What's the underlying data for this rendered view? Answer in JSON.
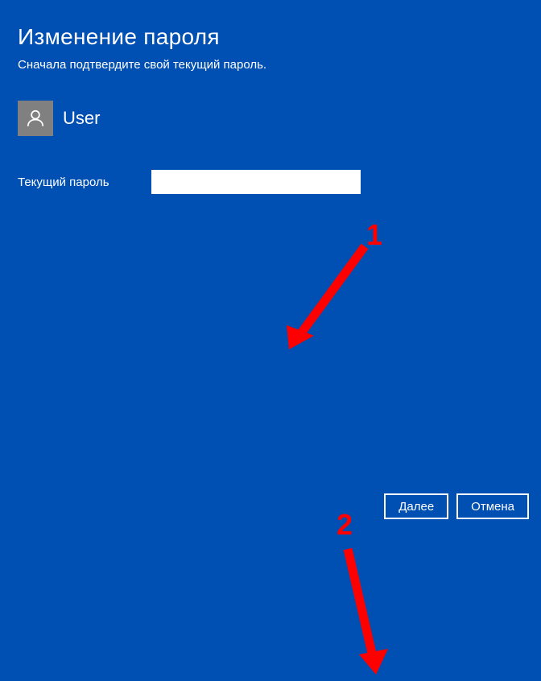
{
  "page": {
    "title": "Изменение пароля",
    "subtitle": "Сначала подтвердите свой текущий пароль."
  },
  "user": {
    "name": "User"
  },
  "fields": {
    "current_password": {
      "label": "Текущий пароль",
      "value": "",
      "placeholder": ""
    }
  },
  "buttons": {
    "next": "Далее",
    "cancel": "Отмена"
  },
  "annotations": {
    "one": "1",
    "two": "2"
  },
  "colors": {
    "background": "#004fb3",
    "annotation": "#ff0000",
    "button_border": "#ffffff"
  }
}
